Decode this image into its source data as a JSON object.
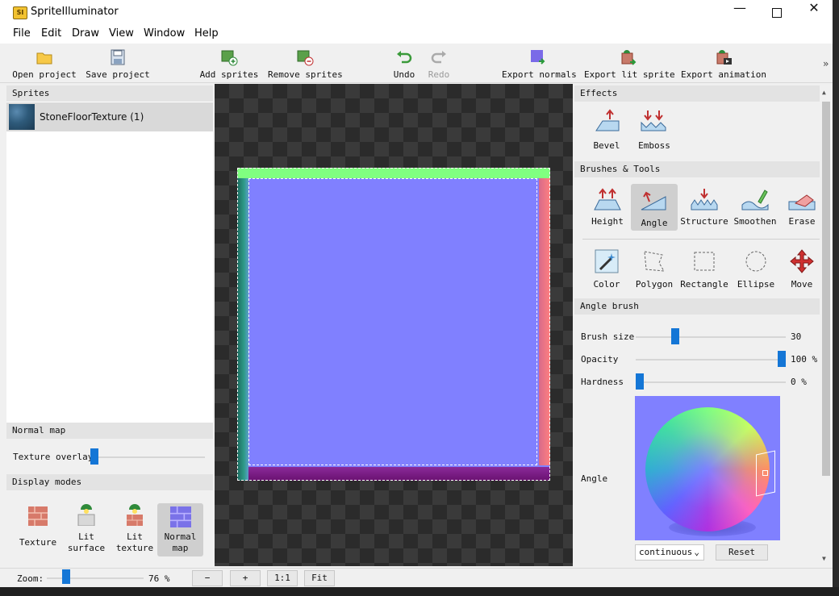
{
  "window": {
    "title": "SpriteIlluminator",
    "app_icon": "SI"
  },
  "menu": [
    "File",
    "Edit",
    "Draw",
    "View",
    "Window",
    "Help"
  ],
  "toolbar": {
    "open_project": "Open project",
    "save_project": "Save project",
    "add_sprites": "Add sprites",
    "remove_sprites": "Remove sprites",
    "undo": "Undo",
    "redo": "Redo",
    "export_normals": "Export normals",
    "export_lit_sprite": "Export lit sprite",
    "export_animation": "Export animation",
    "overflow": "»"
  },
  "sprites_panel": {
    "header": "Sprites",
    "items": [
      {
        "name": "StoneFloorTexture (1)"
      }
    ]
  },
  "normal_map_panel": {
    "header": "Normal map",
    "texture_overlay_label": "Texture overlay",
    "texture_overlay_value": 0
  },
  "display_modes": {
    "header": "Display modes",
    "items": [
      {
        "label": "Texture",
        "icon": "brick-icon"
      },
      {
        "label": "Lit\nsurface",
        "icon": "lamp-surface-icon"
      },
      {
        "label": "Lit\ntexture",
        "icon": "lamp-brick-icon"
      },
      {
        "label": "Normal\nmap",
        "icon": "normal-map-icon",
        "selected": true
      }
    ]
  },
  "effects": {
    "header": "Effects",
    "bevel": "Bevel",
    "emboss": "Emboss"
  },
  "brushes": {
    "header": "Brushes & Tools",
    "height": "Height",
    "angle": "Angle",
    "structure": "Structure",
    "smoothen": "Smoothen",
    "erase": "Erase",
    "color": "Color",
    "polygon": "Polygon",
    "rectangle": "Rectangle",
    "ellipse": "Ellipse",
    "move": "Move",
    "selected": "Angle"
  },
  "angle_brush": {
    "header": "Angle brush",
    "brush_size_label": "Brush size",
    "brush_size_value": "30",
    "brush_size_fraction": 0.25,
    "opacity_label": "Opacity",
    "opacity_value": "100 %",
    "opacity_fraction": 1.0,
    "hardness_label": "Hardness",
    "hardness_value": "0 %",
    "hardness_fraction": 0.0,
    "angle_label": "Angle",
    "mode_value": "continuous",
    "reset_label": "Reset"
  },
  "status": {
    "zoom_label": "Zoom:",
    "zoom_value": "76 %",
    "zoom_fraction": 0.17,
    "minus": "−",
    "plus": "+",
    "one_to_one": "1:1",
    "fit": "Fit"
  },
  "colors": {
    "normal_blue": "#8080ff",
    "selection_blue": "#1476d6",
    "accent_green": "#80ff80",
    "edge_red": "#ff8080",
    "edge_purple": "#7a1a80",
    "edge_teal": "#1f7a70"
  }
}
